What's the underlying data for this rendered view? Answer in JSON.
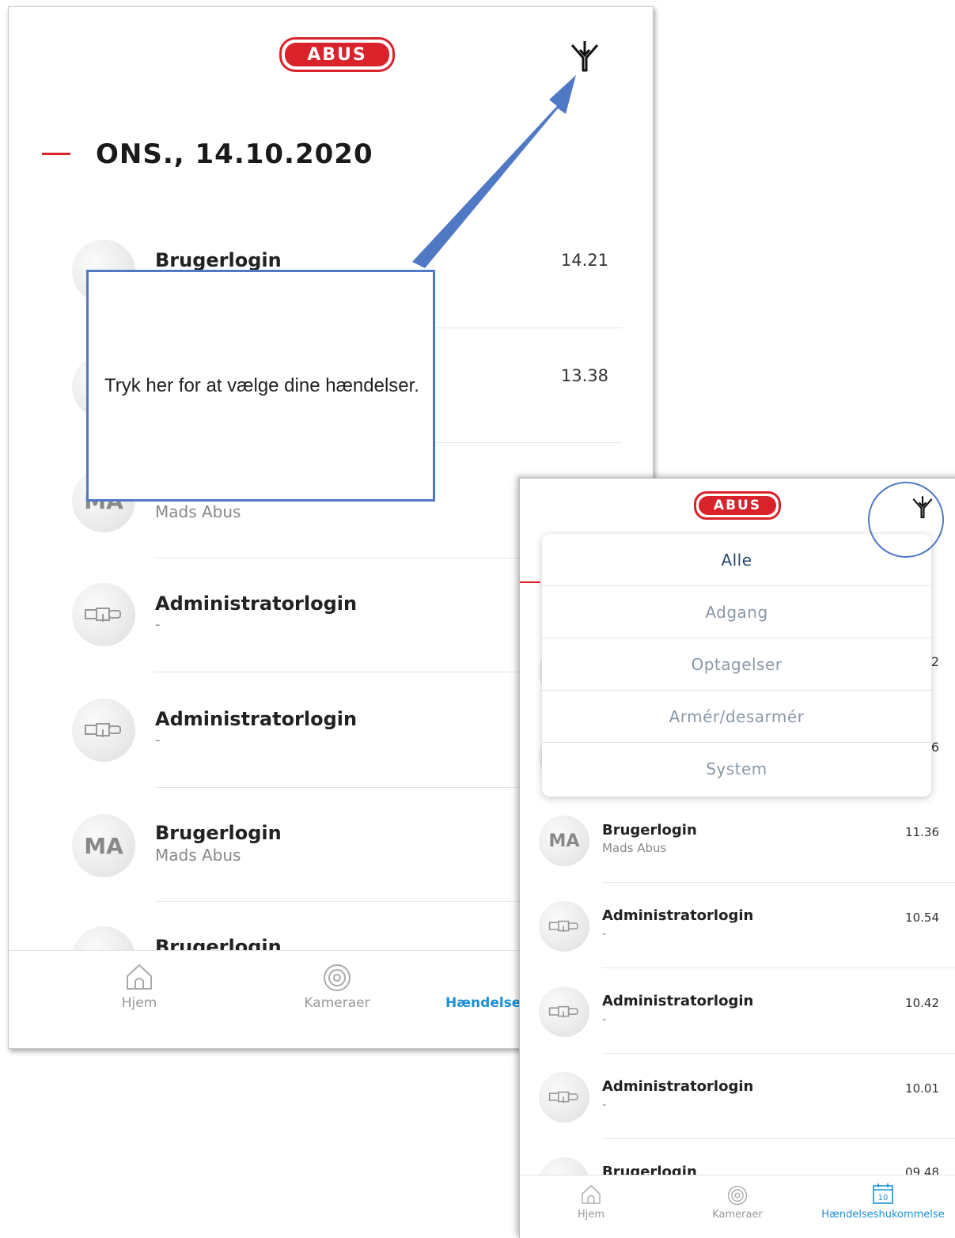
{
  "brand": {
    "logo_text": "ABUS",
    "accent_color": "#d9222a"
  },
  "screen1": {
    "date_heading": "ONS., 14.10.2020",
    "events": [
      {
        "avatar": "",
        "title": "Brugerlogin",
        "subtitle": "",
        "time": "14.21"
      },
      {
        "avatar": "",
        "title": "",
        "subtitle": "",
        "time": "13.38"
      },
      {
        "avatar": "MA",
        "title": "",
        "subtitle": "Mads Abus",
        "time": ""
      },
      {
        "avatar": "lock-icon",
        "title": "Administratorlogin",
        "subtitle": "-",
        "time": ""
      },
      {
        "avatar": "lock-icon",
        "title": "Administratorlogin",
        "subtitle": "-",
        "time": ""
      },
      {
        "avatar": "MA",
        "title": "Brugerlogin",
        "subtitle": "Mads Abus",
        "time": ""
      },
      {
        "avatar": "",
        "title": "Brugerlogin",
        "subtitle": "",
        "time": ""
      }
    ],
    "callout_text": "Tryk her for at vælge dine hændelser.",
    "nav": {
      "home": "Hjem",
      "cameras": "Kameraer",
      "events": "Hændelse"
    }
  },
  "screen2": {
    "filter_options": [
      "Alle",
      "Adgang",
      "Optagelser",
      "Armér/desarmér",
      "System"
    ],
    "selected_filter": "Alle",
    "partial_times": [
      "2",
      "6"
    ],
    "events": [
      {
        "avatar": "MA",
        "title": "Brugerlogin",
        "subtitle": "Mads Abus",
        "time": "11.36"
      },
      {
        "avatar": "lock-icon",
        "title": "Administratorlogin",
        "subtitle": "-",
        "time": "10.54"
      },
      {
        "avatar": "lock-icon",
        "title": "Administratorlogin",
        "subtitle": "-",
        "time": "10.42"
      },
      {
        "avatar": "lock-icon",
        "title": "Administratorlogin",
        "subtitle": "-",
        "time": "10.01"
      },
      {
        "avatar": "",
        "title": "Brugerlogin",
        "subtitle": "",
        "time": "09.48"
      }
    ],
    "nav": {
      "home": "Hjem",
      "cameras": "Kameraer",
      "events": "Hændelseshukommelse",
      "calendar_day": "10"
    }
  }
}
